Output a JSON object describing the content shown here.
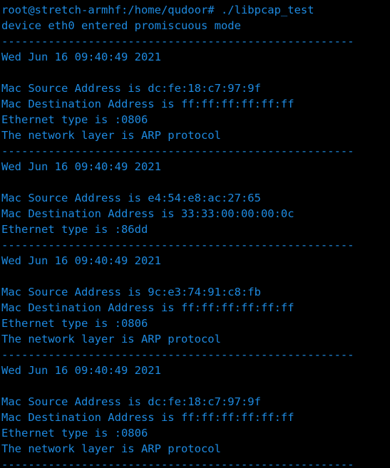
{
  "terminal": {
    "shell_prompt": "root@stretch-armhf:/home/qudoor#",
    "command": "./libpcap_test",
    "background_color": "#000000",
    "text_color": "#1e8ae0",
    "separator": "-----------------------------------------------------",
    "lines": [
      "root@stretch-armhf:/home/qudoor# ./libpcap_test",
      "device eth0 entered promiscuous mode",
      "-----------------------------------------------------",
      "Wed Jun 16 09:40:49 2021",
      "",
      "Mac Source Address is dc:fe:18:c7:97:9f",
      "Mac Destination Address is ff:ff:ff:ff:ff:ff",
      "Ethernet type is :0806",
      "The network layer is ARP protocol",
      "-----------------------------------------------------",
      "Wed Jun 16 09:40:49 2021",
      "",
      "Mac Source Address is e4:54:e8:ac:27:65",
      "Mac Destination Address is 33:33:00:00:00:0c",
      "Ethernet type is :86dd",
      "-----------------------------------------------------",
      "Wed Jun 16 09:40:49 2021",
      "",
      "Mac Source Address is 9c:e3:74:91:c8:fb",
      "Mac Destination Address is ff:ff:ff:ff:ff:ff",
      "Ethernet type is :0806",
      "The network layer is ARP protocol",
      "-----------------------------------------------------",
      "Wed Jun 16 09:40:49 2021",
      "",
      "Mac Source Address is dc:fe:18:c7:97:9f",
      "Mac Destination Address is ff:ff:ff:ff:ff:ff",
      "Ethernet type is :0806",
      "The network layer is ARP protocol",
      "-----------------------------------------------------"
    ],
    "packets": [
      {
        "timestamp": "Wed Jun 16 09:40:49 2021",
        "mac_source_label": "Mac Source Address is",
        "mac_source": "dc:fe:18:c7:97:9f",
        "mac_destination_label": "Mac Destination Address is",
        "mac_destination": "ff:ff:ff:ff:ff:ff",
        "ethernet_type_label": "Ethernet type is",
        "ethernet_type": ":0806",
        "network_layer": "The network layer is ARP protocol"
      },
      {
        "timestamp": "Wed Jun 16 09:40:49 2021",
        "mac_source_label": "Mac Source Address is",
        "mac_source": "e4:54:e8:ac:27:65",
        "mac_destination_label": "Mac Destination Address is",
        "mac_destination": "33:33:00:00:00:0c",
        "ethernet_type_label": "Ethernet type is",
        "ethernet_type": ":86dd",
        "network_layer": ""
      },
      {
        "timestamp": "Wed Jun 16 09:40:49 2021",
        "mac_source_label": "Mac Source Address is",
        "mac_source": "9c:e3:74:91:c8:fb",
        "mac_destination_label": "Mac Destination Address is",
        "mac_destination": "ff:ff:ff:ff:ff:ff",
        "ethernet_type_label": "Ethernet type is",
        "ethernet_type": ":0806",
        "network_layer": "The network layer is ARP protocol"
      },
      {
        "timestamp": "Wed Jun 16 09:40:49 2021",
        "mac_source_label": "Mac Source Address is",
        "mac_source": "dc:fe:18:c7:97:9f",
        "mac_destination_label": "Mac Destination Address is",
        "mac_destination": "ff:ff:ff:ff:ff:ff",
        "ethernet_type_label": "Ethernet type is",
        "ethernet_type": ":0806",
        "network_layer": "The network layer is ARP protocol"
      }
    ],
    "status_message": "device eth0 entered promiscuous mode",
    "device": "eth0"
  }
}
